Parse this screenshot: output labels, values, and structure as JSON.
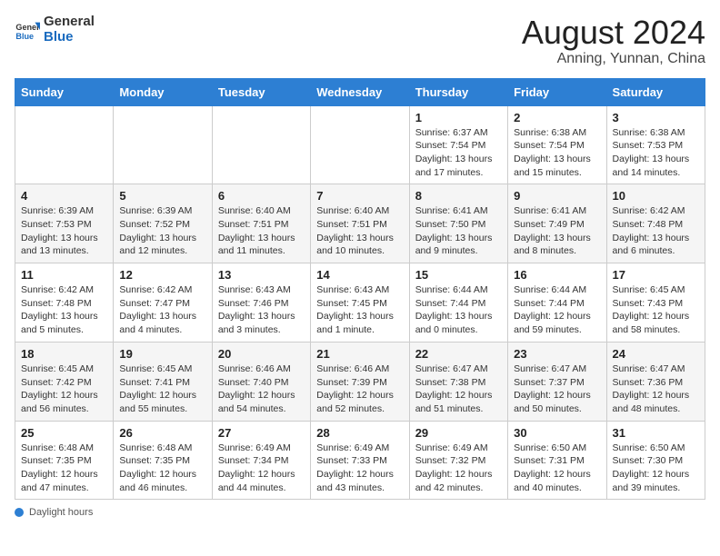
{
  "header": {
    "logo_general": "General",
    "logo_blue": "Blue",
    "title": "August 2024",
    "location": "Anning, Yunnan, China"
  },
  "footer": {
    "label": "Daylight hours"
  },
  "weekdays": [
    "Sunday",
    "Monday",
    "Tuesday",
    "Wednesday",
    "Thursday",
    "Friday",
    "Saturday"
  ],
  "weeks": [
    [
      {
        "day": "",
        "content": ""
      },
      {
        "day": "",
        "content": ""
      },
      {
        "day": "",
        "content": ""
      },
      {
        "day": "",
        "content": ""
      },
      {
        "day": "1",
        "content": "Sunrise: 6:37 AM\nSunset: 7:54 PM\nDaylight: 13 hours and 17 minutes."
      },
      {
        "day": "2",
        "content": "Sunrise: 6:38 AM\nSunset: 7:54 PM\nDaylight: 13 hours and 15 minutes."
      },
      {
        "day": "3",
        "content": "Sunrise: 6:38 AM\nSunset: 7:53 PM\nDaylight: 13 hours and 14 minutes."
      }
    ],
    [
      {
        "day": "4",
        "content": "Sunrise: 6:39 AM\nSunset: 7:53 PM\nDaylight: 13 hours and 13 minutes."
      },
      {
        "day": "5",
        "content": "Sunrise: 6:39 AM\nSunset: 7:52 PM\nDaylight: 13 hours and 12 minutes."
      },
      {
        "day": "6",
        "content": "Sunrise: 6:40 AM\nSunset: 7:51 PM\nDaylight: 13 hours and 11 minutes."
      },
      {
        "day": "7",
        "content": "Sunrise: 6:40 AM\nSunset: 7:51 PM\nDaylight: 13 hours and 10 minutes."
      },
      {
        "day": "8",
        "content": "Sunrise: 6:41 AM\nSunset: 7:50 PM\nDaylight: 13 hours and 9 minutes."
      },
      {
        "day": "9",
        "content": "Sunrise: 6:41 AM\nSunset: 7:49 PM\nDaylight: 13 hours and 8 minutes."
      },
      {
        "day": "10",
        "content": "Sunrise: 6:42 AM\nSunset: 7:48 PM\nDaylight: 13 hours and 6 minutes."
      }
    ],
    [
      {
        "day": "11",
        "content": "Sunrise: 6:42 AM\nSunset: 7:48 PM\nDaylight: 13 hours and 5 minutes."
      },
      {
        "day": "12",
        "content": "Sunrise: 6:42 AM\nSunset: 7:47 PM\nDaylight: 13 hours and 4 minutes."
      },
      {
        "day": "13",
        "content": "Sunrise: 6:43 AM\nSunset: 7:46 PM\nDaylight: 13 hours and 3 minutes."
      },
      {
        "day": "14",
        "content": "Sunrise: 6:43 AM\nSunset: 7:45 PM\nDaylight: 13 hours and 1 minute."
      },
      {
        "day": "15",
        "content": "Sunrise: 6:44 AM\nSunset: 7:44 PM\nDaylight: 13 hours and 0 minutes."
      },
      {
        "day": "16",
        "content": "Sunrise: 6:44 AM\nSunset: 7:44 PM\nDaylight: 12 hours and 59 minutes."
      },
      {
        "day": "17",
        "content": "Sunrise: 6:45 AM\nSunset: 7:43 PM\nDaylight: 12 hours and 58 minutes."
      }
    ],
    [
      {
        "day": "18",
        "content": "Sunrise: 6:45 AM\nSunset: 7:42 PM\nDaylight: 12 hours and 56 minutes."
      },
      {
        "day": "19",
        "content": "Sunrise: 6:45 AM\nSunset: 7:41 PM\nDaylight: 12 hours and 55 minutes."
      },
      {
        "day": "20",
        "content": "Sunrise: 6:46 AM\nSunset: 7:40 PM\nDaylight: 12 hours and 54 minutes."
      },
      {
        "day": "21",
        "content": "Sunrise: 6:46 AM\nSunset: 7:39 PM\nDaylight: 12 hours and 52 minutes."
      },
      {
        "day": "22",
        "content": "Sunrise: 6:47 AM\nSunset: 7:38 PM\nDaylight: 12 hours and 51 minutes."
      },
      {
        "day": "23",
        "content": "Sunrise: 6:47 AM\nSunset: 7:37 PM\nDaylight: 12 hours and 50 minutes."
      },
      {
        "day": "24",
        "content": "Sunrise: 6:47 AM\nSunset: 7:36 PM\nDaylight: 12 hours and 48 minutes."
      }
    ],
    [
      {
        "day": "25",
        "content": "Sunrise: 6:48 AM\nSunset: 7:35 PM\nDaylight: 12 hours and 47 minutes."
      },
      {
        "day": "26",
        "content": "Sunrise: 6:48 AM\nSunset: 7:35 PM\nDaylight: 12 hours and 46 minutes."
      },
      {
        "day": "27",
        "content": "Sunrise: 6:49 AM\nSunset: 7:34 PM\nDaylight: 12 hours and 44 minutes."
      },
      {
        "day": "28",
        "content": "Sunrise: 6:49 AM\nSunset: 7:33 PM\nDaylight: 12 hours and 43 minutes."
      },
      {
        "day": "29",
        "content": "Sunrise: 6:49 AM\nSunset: 7:32 PM\nDaylight: 12 hours and 42 minutes."
      },
      {
        "day": "30",
        "content": "Sunrise: 6:50 AM\nSunset: 7:31 PM\nDaylight: 12 hours and 40 minutes."
      },
      {
        "day": "31",
        "content": "Sunrise: 6:50 AM\nSunset: 7:30 PM\nDaylight: 12 hours and 39 minutes."
      }
    ]
  ]
}
